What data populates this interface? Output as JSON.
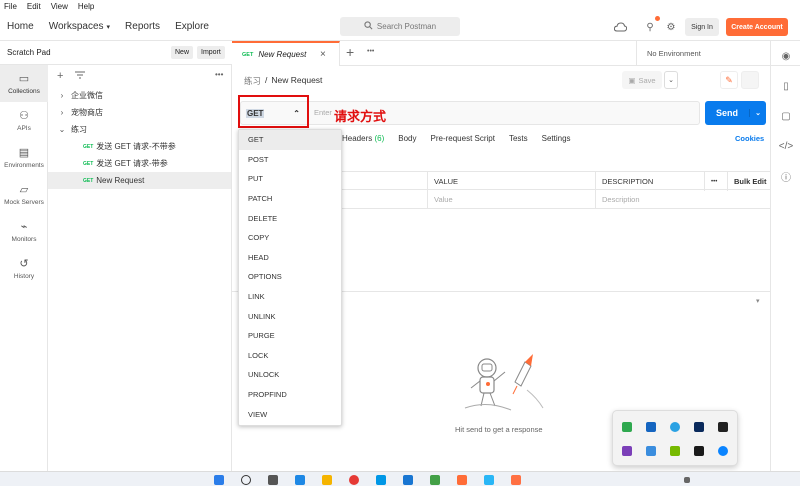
{
  "menubar": [
    "File",
    "Edit",
    "View",
    "Help"
  ],
  "header": {
    "nav": [
      "Home",
      "Workspaces",
      "Reports",
      "Explore"
    ],
    "search_placeholder": "Search Postman",
    "signin": "Sign In",
    "create_account": "Create Account"
  },
  "sidebar": {
    "scratch_title": "Scratch Pad",
    "new_label": "New",
    "import_label": "Import",
    "icons": [
      {
        "label": "Collections",
        "icon": "collections-icon"
      },
      {
        "label": "APIs",
        "icon": "apis-icon"
      },
      {
        "label": "Environments",
        "icon": "environments-icon"
      },
      {
        "label": "Mock Servers",
        "icon": "mock-servers-icon"
      },
      {
        "label": "Monitors",
        "icon": "monitors-icon"
      },
      {
        "label": "History",
        "icon": "history-icon"
      }
    ],
    "tree": [
      {
        "label": "企业微信",
        "chevron": "›"
      },
      {
        "label": "宠物商店",
        "chevron": "›"
      },
      {
        "label": "练习",
        "chevron": "⌄"
      },
      {
        "method": "GET",
        "label": "发送 GET 请求-不带参"
      },
      {
        "method": "GET",
        "label": "发送 GET 请求-带参"
      },
      {
        "method": "GET",
        "label": "New Request"
      }
    ]
  },
  "tab": {
    "method": "GET",
    "title": "New Request",
    "environment": "No Environment"
  },
  "breadcrumb": {
    "parent": "练习",
    "separator": "/",
    "current": "New Request"
  },
  "save_label": "Save",
  "request": {
    "method": "GET",
    "url_placeholder": "Enter",
    "annotation": "请求方式",
    "send": "Send"
  },
  "request_tabs": {
    "headers": "Headers",
    "headers_count": "(6)",
    "body": "Body",
    "prerequest": "Pre-request Script",
    "tests": "Tests",
    "settings": "Settings",
    "cookies": "Cookies"
  },
  "params": {
    "col_value": "VALUE",
    "col_description": "DESCRIPTION",
    "bulk_edit": "Bulk Edit",
    "ph_value": "Value",
    "ph_description": "Description",
    "more": "•••"
  },
  "response": {
    "hint": "Hit send to get a response"
  },
  "methods": [
    "GET",
    "POST",
    "PUT",
    "PATCH",
    "DELETE",
    "COPY",
    "HEAD",
    "OPTIONS",
    "LINK",
    "UNLINK",
    "PURGE",
    "LOCK",
    "UNLOCK",
    "PROPFIND",
    "VIEW"
  ],
  "colors": {
    "accent": "#ff6c37",
    "send": "#097bed",
    "get": "#0cbb52",
    "annotation": "#e10e0e"
  }
}
